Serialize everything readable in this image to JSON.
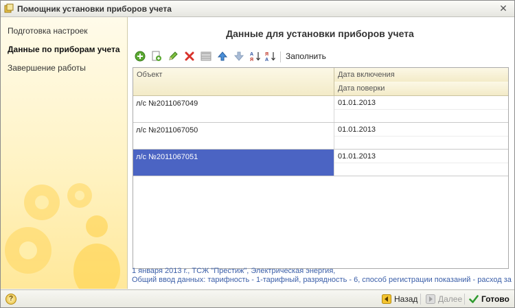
{
  "window": {
    "title": "Помощник установки приборов учета",
    "close_label": "✕"
  },
  "sidebar": {
    "items": [
      {
        "label": "Подготовка настроек",
        "active": false
      },
      {
        "label": "Данные по приборам учета",
        "active": true
      },
      {
        "label": "Завершение работы",
        "active": false
      }
    ]
  },
  "main": {
    "heading": "Данные для установки приборов учета",
    "toolbar": {
      "buttons": [
        {
          "icon": "add-icon",
          "title": "Добавить"
        },
        {
          "icon": "copy-icon",
          "title": "Скопировать"
        },
        {
          "icon": "edit-icon",
          "title": "Изменить"
        },
        {
          "icon": "delete-icon",
          "title": "Удалить"
        },
        {
          "icon": "table-icon",
          "title": "Таблица"
        },
        {
          "icon": "move-up-icon",
          "title": "Переместить вверх"
        },
        {
          "icon": "move-down-icon",
          "title": "Переместить вниз"
        },
        {
          "icon": "sort-asc-icon",
          "title": "Сортировать по возрастанию"
        },
        {
          "icon": "sort-desc-icon",
          "title": "Сортировать по убыванию"
        }
      ],
      "fill_label": "Заполнить"
    },
    "table": {
      "columns": {
        "object": "Объект",
        "date_on": "Дата включения",
        "date_check": "Дата поверки"
      },
      "rows": [
        {
          "object": "л/с №2011067049",
          "date_on": "01.01.2013",
          "date_check": ""
        },
        {
          "object": "л/с №2011067050",
          "date_on": "01.01.2013",
          "date_check": ""
        },
        {
          "object": "л/с №2011067051",
          "date_on": "01.01.2013",
          "date_check": ""
        }
      ],
      "selected_index": 2
    },
    "info": {
      "line1": "1 января 2013 г., ТСЖ \"Престиж\", Электрическая энергия,",
      "line2": "Общий ввод данных: тарифность - 1-тарифный, разрядность - 6, способ регистрации показаний - расход за"
    }
  },
  "footer": {
    "help_label": "?",
    "back_label": "Назад",
    "next_label": "Далее",
    "done_label": "Готово"
  },
  "colors": {
    "selection": "#4b64c3",
    "info_text": "#3a5ea8",
    "header_bg": "#f3ebc8"
  }
}
